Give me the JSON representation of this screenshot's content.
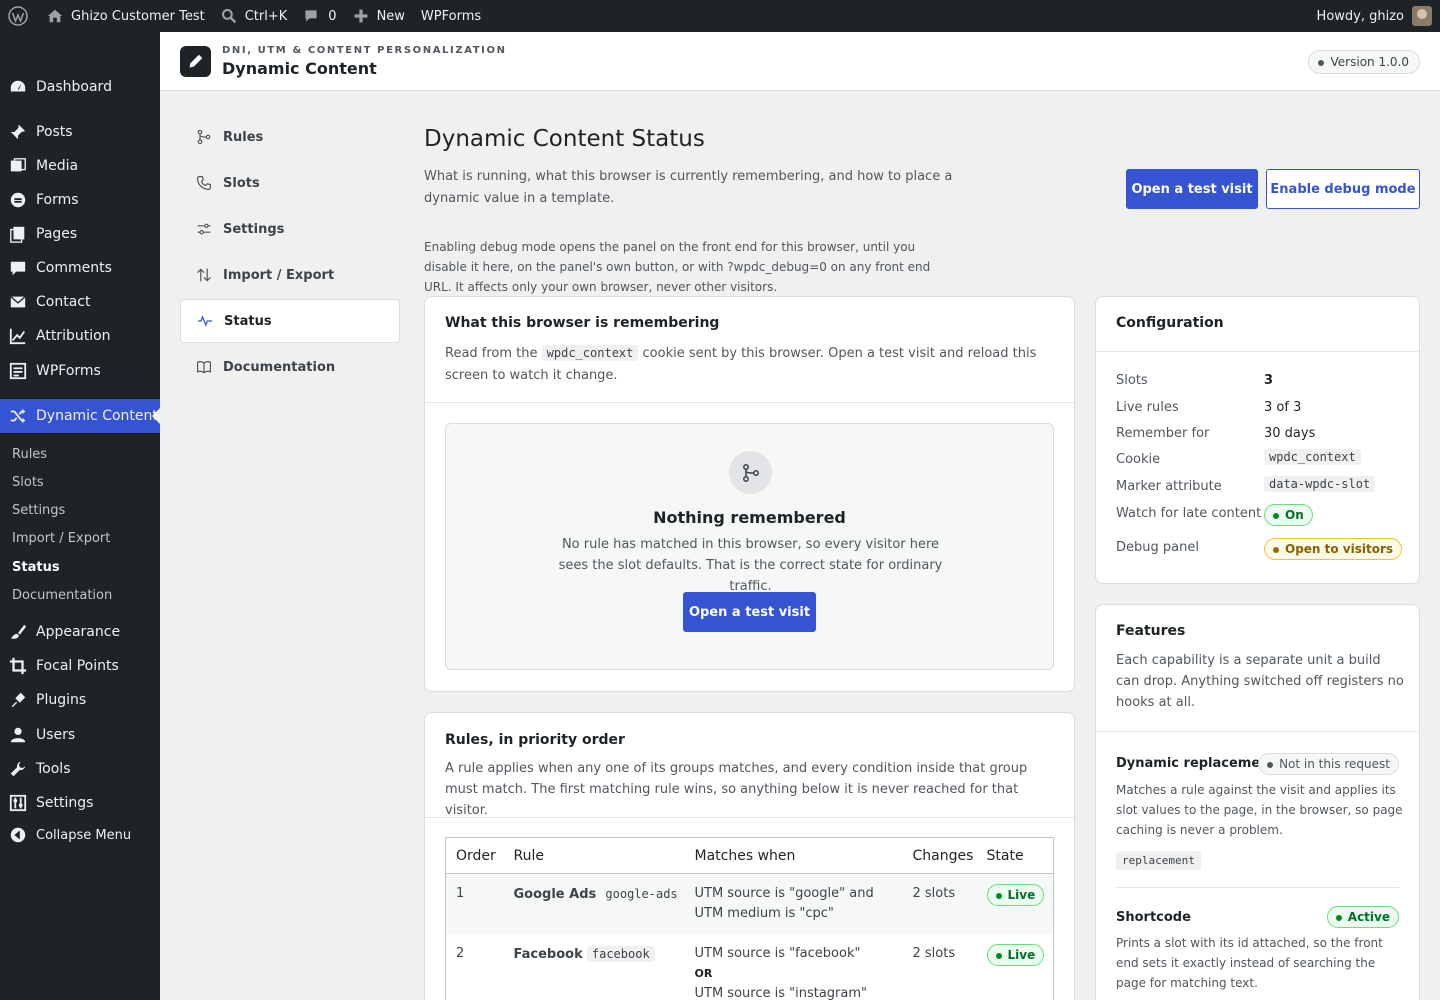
{
  "admin_bar": {
    "site_name": "Ghizo Customer Test",
    "search_shortcut": "Ctrl+K",
    "comments_count": "0",
    "new_label": "New",
    "wpforms_label": "WPForms",
    "greeting": "Howdy, ghizo"
  },
  "admin_menu": {
    "items": [
      {
        "label": "Dashboard",
        "icon": "dashboard-icon"
      },
      {
        "label": "Posts",
        "icon": "pin-icon"
      },
      {
        "label": "Media",
        "icon": "media-icon"
      },
      {
        "label": "Forms",
        "icon": "forms-icon"
      },
      {
        "label": "Pages",
        "icon": "pages-icon"
      },
      {
        "label": "Comments",
        "icon": "comment-icon"
      },
      {
        "label": "Contact",
        "icon": "mail-icon"
      },
      {
        "label": "Attribution",
        "icon": "chart-icon"
      },
      {
        "label": "WPForms",
        "icon": "wpforms-icon"
      },
      {
        "label": "Dynamic Content",
        "icon": "shuffle-icon"
      },
      {
        "label": "Appearance",
        "icon": "brush-icon"
      },
      {
        "label": "Focal Points",
        "icon": "crop-icon"
      },
      {
        "label": "Plugins",
        "icon": "plug-icon"
      },
      {
        "label": "Users",
        "icon": "user-icon"
      },
      {
        "label": "Tools",
        "icon": "wrench-icon"
      },
      {
        "label": "Settings",
        "icon": "sliders-icon"
      },
      {
        "label": "Collapse Menu",
        "icon": "collapse-icon"
      }
    ],
    "submenu": [
      "Rules",
      "Slots",
      "Settings",
      "Import / Export",
      "Status",
      "Documentation"
    ]
  },
  "plugin_header": {
    "eyebrow": "DNI, UTM & CONTENT PERSONALIZATION",
    "title": "Dynamic Content",
    "version": "Version 1.0.0"
  },
  "plugin_nav": [
    {
      "label": "Rules",
      "icon": "branch-icon"
    },
    {
      "label": "Slots",
      "icon": "phone-icon"
    },
    {
      "label": "Settings",
      "icon": "sliders-icon"
    },
    {
      "label": "Import / Export",
      "icon": "arrows-updown-icon"
    },
    {
      "label": "Status",
      "icon": "pulse-icon"
    },
    {
      "label": "Documentation",
      "icon": "book-icon"
    }
  ],
  "page": {
    "title": "Dynamic Content Status",
    "description": "What is running, what this browser is currently remembering, and how to place a dynamic value in a template.",
    "open_test_visit": "Open a test visit",
    "enable_debug": "Enable debug mode",
    "debug_note": "Enabling debug mode opens the panel on the front end for this browser, until you disable it here, on the panel's own button, or with ?wpdc_debug=0 on any front end URL. It affects only your own browser, never other visitors."
  },
  "remembering": {
    "title": "What this browser is remembering",
    "text_before": "Read from the",
    "cookie": "wpdc_context",
    "text_after": "cookie sent by this browser. Open a test visit and reload this screen to watch it change.",
    "empty_title": "Nothing remembered",
    "empty_text": "No rule has matched in this browser, so every visitor here sees the slot defaults. That is the correct state for ordinary traffic.",
    "empty_button": "Open a test visit"
  },
  "rules": {
    "title": "Rules, in priority order",
    "description": "A rule applies when any one of its groups matches, and every condition inside that group must match. The first matching rule wins, so anything below it is never reached for that visitor.",
    "columns": [
      "Order",
      "Rule",
      "Matches when",
      "Changes",
      "State"
    ],
    "rows": [
      {
        "order": "1",
        "name": "Google Ads",
        "slug": "google-ads",
        "matches": [
          "UTM source is \"google\" and UTM medium is \"cpc\""
        ],
        "changes": "2 slots",
        "state": "Live"
      },
      {
        "order": "2",
        "name": "Facebook",
        "slug": "facebook",
        "matches": [
          "UTM source is \"facebook\"",
          "UTM source is \"instagram\""
        ],
        "or_label": "OR",
        "changes": "2 slots",
        "state": "Live"
      }
    ]
  },
  "configuration": {
    "title": "Configuration",
    "rows": [
      {
        "label": "Slots",
        "value": "3"
      },
      {
        "label": "Live rules",
        "value": "3 of 3"
      },
      {
        "label": "Remember for",
        "value": "30 days"
      },
      {
        "label": "Cookie",
        "value": "wpdc_context"
      },
      {
        "label": "Marker attribute",
        "value": "data-wpdc-slot"
      },
      {
        "label": "Watch for late content",
        "value": "On"
      },
      {
        "label": "Debug panel",
        "value": "Open to visitors"
      }
    ]
  },
  "features": {
    "title": "Features",
    "description": "Each capability is a separate unit a build can drop. Anything switched off registers no hooks at all.",
    "items": [
      {
        "name": "Dynamic replacement",
        "status": "Not in this request",
        "text": "Matches a rule against the visit and applies its slot values to the page, in the browser, so page caching is never a problem.",
        "code": "replacement"
      },
      {
        "name": "Shortcode",
        "status": "Active",
        "text": "Prints a slot with its id attached, so the front end sets it exactly instead of searching the page for matching text."
      }
    ]
  },
  "colors": {
    "accent": "#3454d1",
    "admin_dark": "#1d2327",
    "live_green": "#008a20"
  }
}
